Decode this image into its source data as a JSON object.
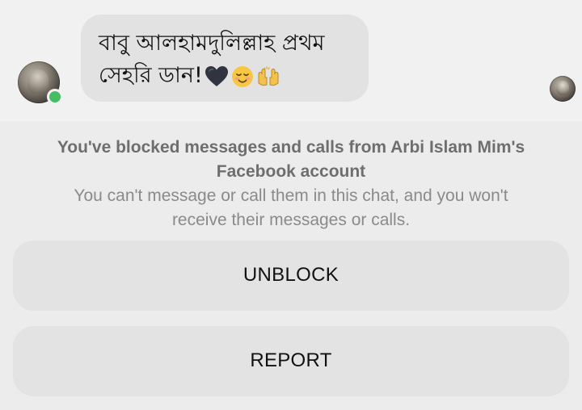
{
  "conversation": {
    "contact_name": "Arbi Islam Mim",
    "contact_online": true,
    "message": {
      "line1": "বাবু আলহামদুলিল্লাহ প্রথম",
      "line2": "সেহরি ডান!",
      "emojis": [
        "black-heart-icon",
        "relieved-face-icon",
        "raising-hands-icon"
      ]
    }
  },
  "blocked_notice": {
    "title_line1": "You've blocked messages and calls from Arbi Islam Mim's",
    "title_line2": "Facebook account",
    "sub_line1": "You can't message or call them in this chat, and you won't",
    "sub_line2": "receive their messages or calls."
  },
  "actions": {
    "unblock_label": "UNBLOCK",
    "report_label": "REPORT"
  },
  "colors": {
    "background": "#ececec",
    "bubble": "#e2e2e2",
    "button": "#e3e3e3",
    "online": "#45bd62",
    "notice_title": "#6e6e6e",
    "notice_sub": "#8a8a8a"
  }
}
